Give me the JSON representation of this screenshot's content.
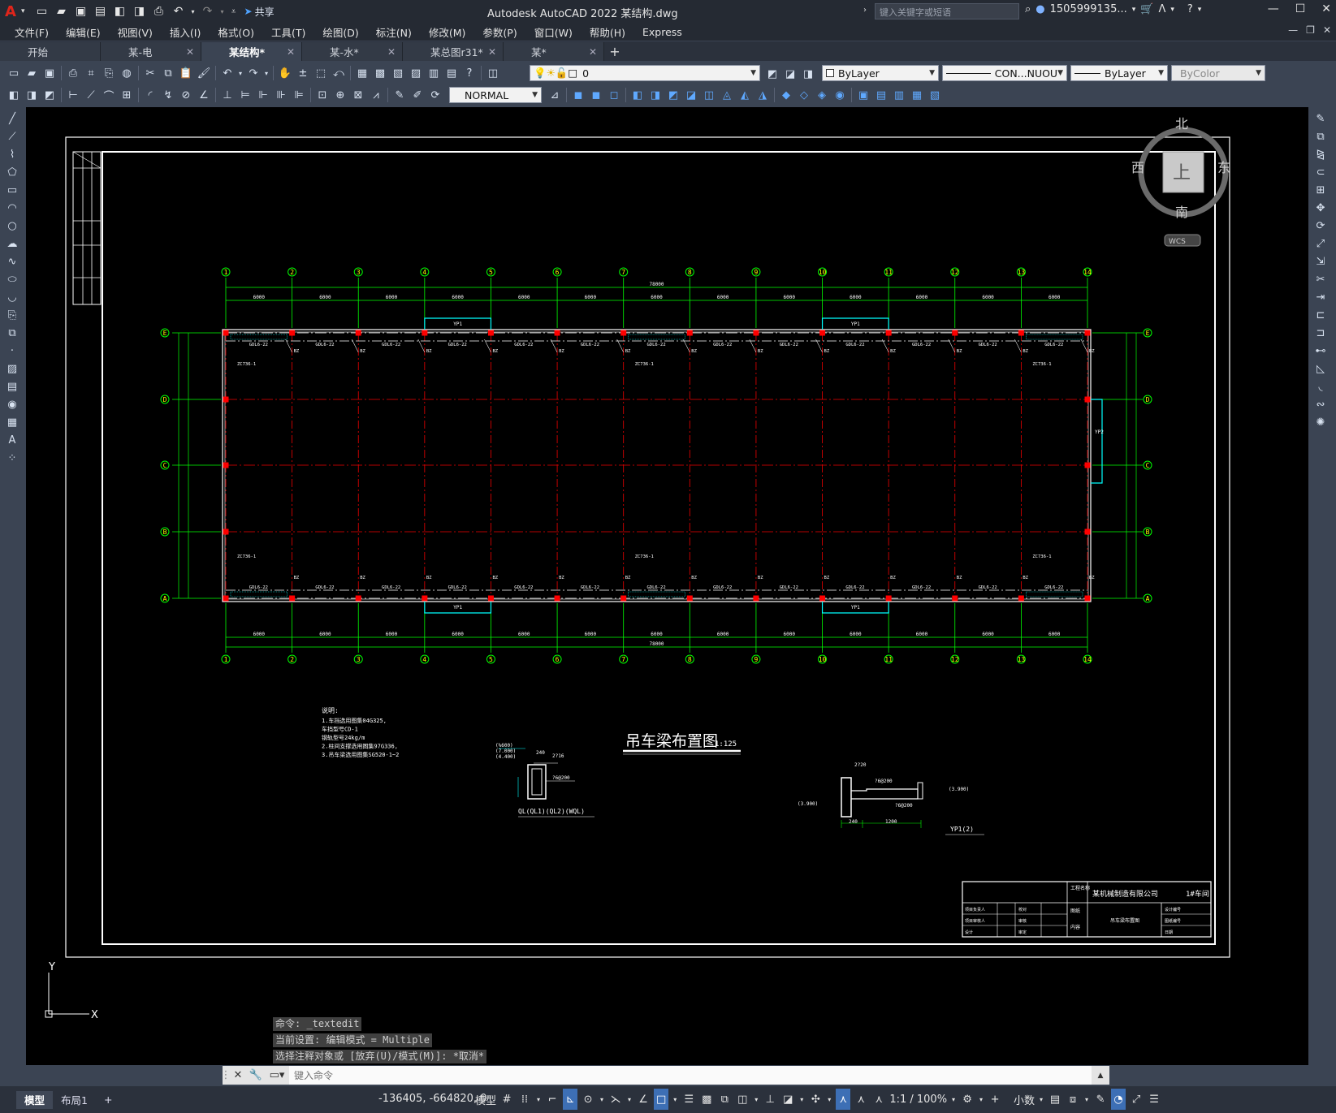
{
  "app": {
    "title": "Autodesk AutoCAD 2022    某结构.dwg",
    "share_label": "共享",
    "search_placeholder": "键入关键字或短语",
    "user": "1505999135...",
    "logo_letter": "A"
  },
  "menu": [
    "文件(F)",
    "编辑(E)",
    "视图(V)",
    "插入(I)",
    "格式(O)",
    "工具(T)",
    "绘图(D)",
    "标注(N)",
    "修改(M)",
    "参数(P)",
    "窗口(W)",
    "帮助(H)",
    "Express"
  ],
  "file_tabs": [
    {
      "label": "开始",
      "closable": false,
      "active": false
    },
    {
      "label": "某-电",
      "closable": true,
      "active": false
    },
    {
      "label": "某结构*",
      "closable": true,
      "active": true
    },
    {
      "label": "某-水*",
      "closable": true,
      "active": false
    },
    {
      "label": "某总图r31*",
      "closable": true,
      "active": false
    },
    {
      "label": "某*",
      "closable": true,
      "active": false
    }
  ],
  "toolbar": {
    "layer_value": "0",
    "color_value": "ByLayer",
    "linetype_value": "CON...NUOU",
    "lineweight_value": "ByLayer",
    "plotstyle_value": "ByColor",
    "dimstyle_value": "NORMAL"
  },
  "viewcube": {
    "north": "北",
    "south": "南",
    "east": "东",
    "west": "西",
    "face": "上",
    "wcs": "WCS"
  },
  "drawing": {
    "title": "吊车梁布置图",
    "scale": "1:125",
    "total_dim": "78000",
    "grid_x": [
      "1",
      "2",
      "3",
      "4",
      "5",
      "6",
      "7",
      "8",
      "9",
      "10",
      "11",
      "12",
      "13",
      "14"
    ],
    "grid_y": [
      "E",
      "D",
      "C",
      "B",
      "A"
    ],
    "span": "6000",
    "notes_title": "说明:",
    "notes": [
      "1.车挡选用图集04G325,",
      "  车挡型号CD-1",
      "  钢轨型号24kg/m",
      "2.柱间支撑选用图集97G336,",
      "3.吊车梁选用图集SG520-1~2"
    ],
    "section1_label": "QL(QL1)(QL2)(WQL)",
    "section2_label": "YP1(2)",
    "titleblock": {
      "company": "某机械制造有限公司",
      "project": "1#车间",
      "drawing_name": "吊车梁布置图",
      "rows": [
        "项目负责人",
        "项目审核人",
        "设计"
      ],
      "mid": [
        "校对",
        "审核",
        "审定"
      ],
      "labels": [
        "图纸",
        "内容"
      ],
      "right": [
        "设计编号",
        "图纸编号",
        "日期"
      ],
      "proj_label": "工程名称"
    }
  },
  "command": {
    "history": [
      "命令: _textedit",
      "当前设置: 编辑模式 = Multiple",
      "选择注释对象或 [放弃(U)/模式(M)]: *取消*"
    ],
    "placeholder": "键入命令"
  },
  "status": {
    "layout_tabs": [
      "模型",
      "布局1"
    ],
    "coords": "-136405, -664820, 0",
    "model_label": "模型",
    "scale": "1:1 / 100%",
    "units": "小数"
  },
  "ucs": {
    "y": "Y",
    "x": "X"
  }
}
